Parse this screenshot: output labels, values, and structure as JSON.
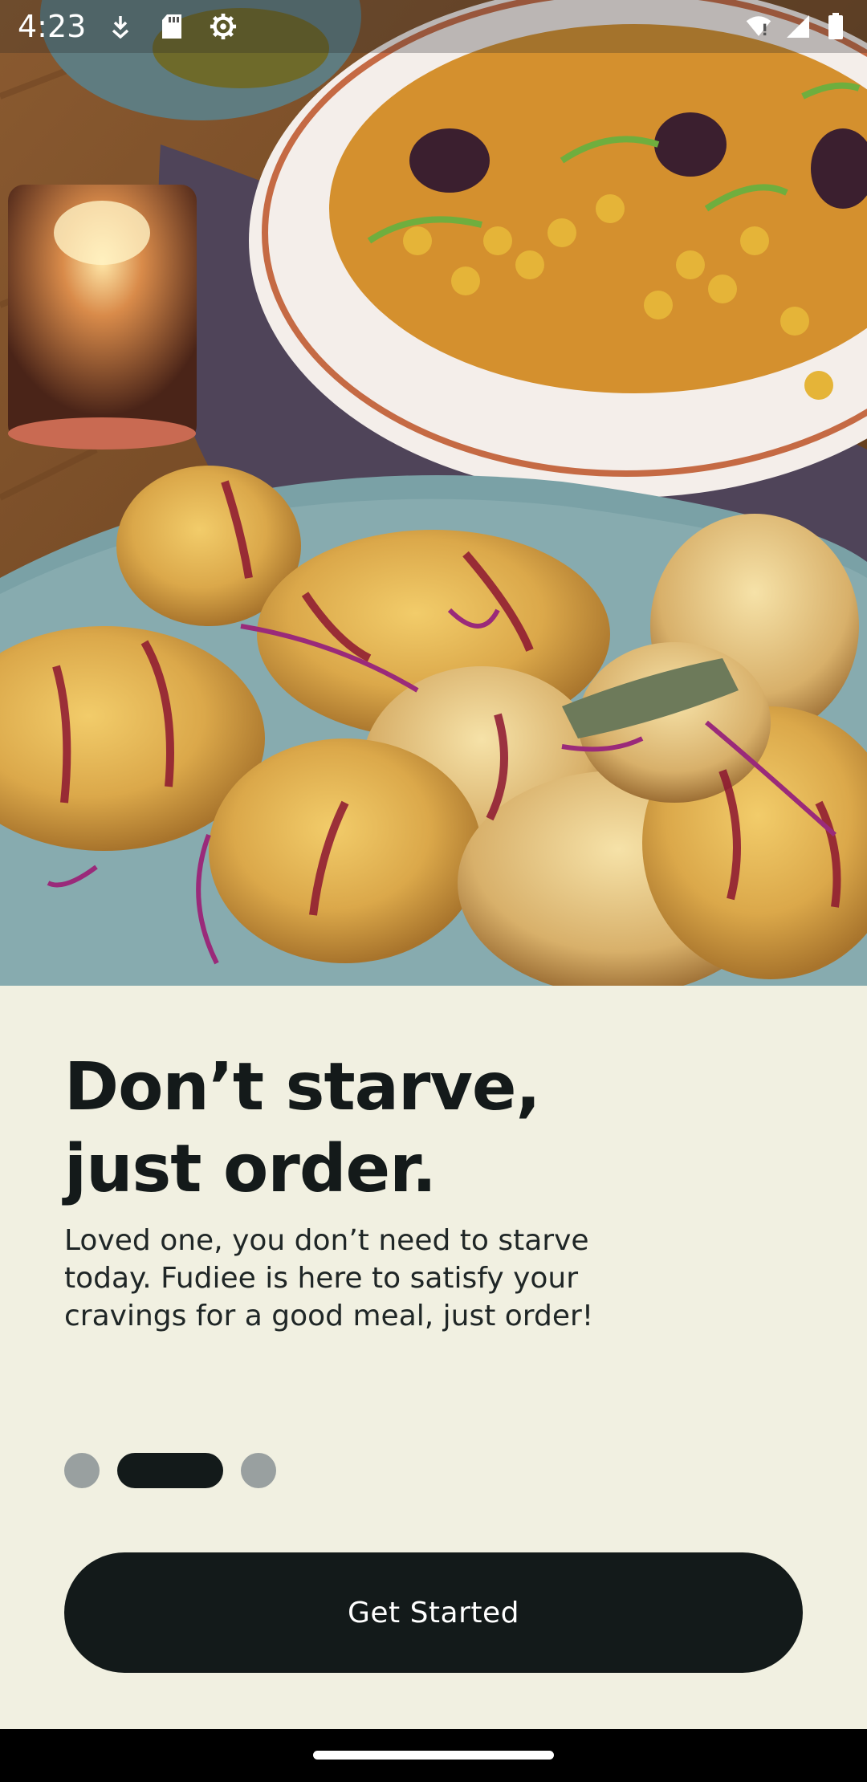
{
  "status_bar": {
    "time": "4:23",
    "icons_left": [
      "download-icon",
      "sd-card-icon",
      "settings-gear-icon"
    ],
    "icons_right": [
      "wifi-alert-icon",
      "cell-signal-icon",
      "battery-icon"
    ]
  },
  "hero": {
    "image_subject": "roasted chicken platter with chickpea salad and candle"
  },
  "onboarding": {
    "headline_line1": "Don’t starve,",
    "headline_line2": "just order.",
    "body_line1": "Loved one, you don’t need to starve",
    "body_line2": "today. Fudiee is here to satisfy your",
    "body_line3": "cravings for a good meal, just order!",
    "page_indicator": {
      "total": 3,
      "active_index": 1
    },
    "cta_label": "Get Started"
  },
  "colors": {
    "background": "#f1f0e1",
    "primary_dark": "#131a1a",
    "dot_inactive": "#99a0a0",
    "cta_text": "#ffffff"
  }
}
